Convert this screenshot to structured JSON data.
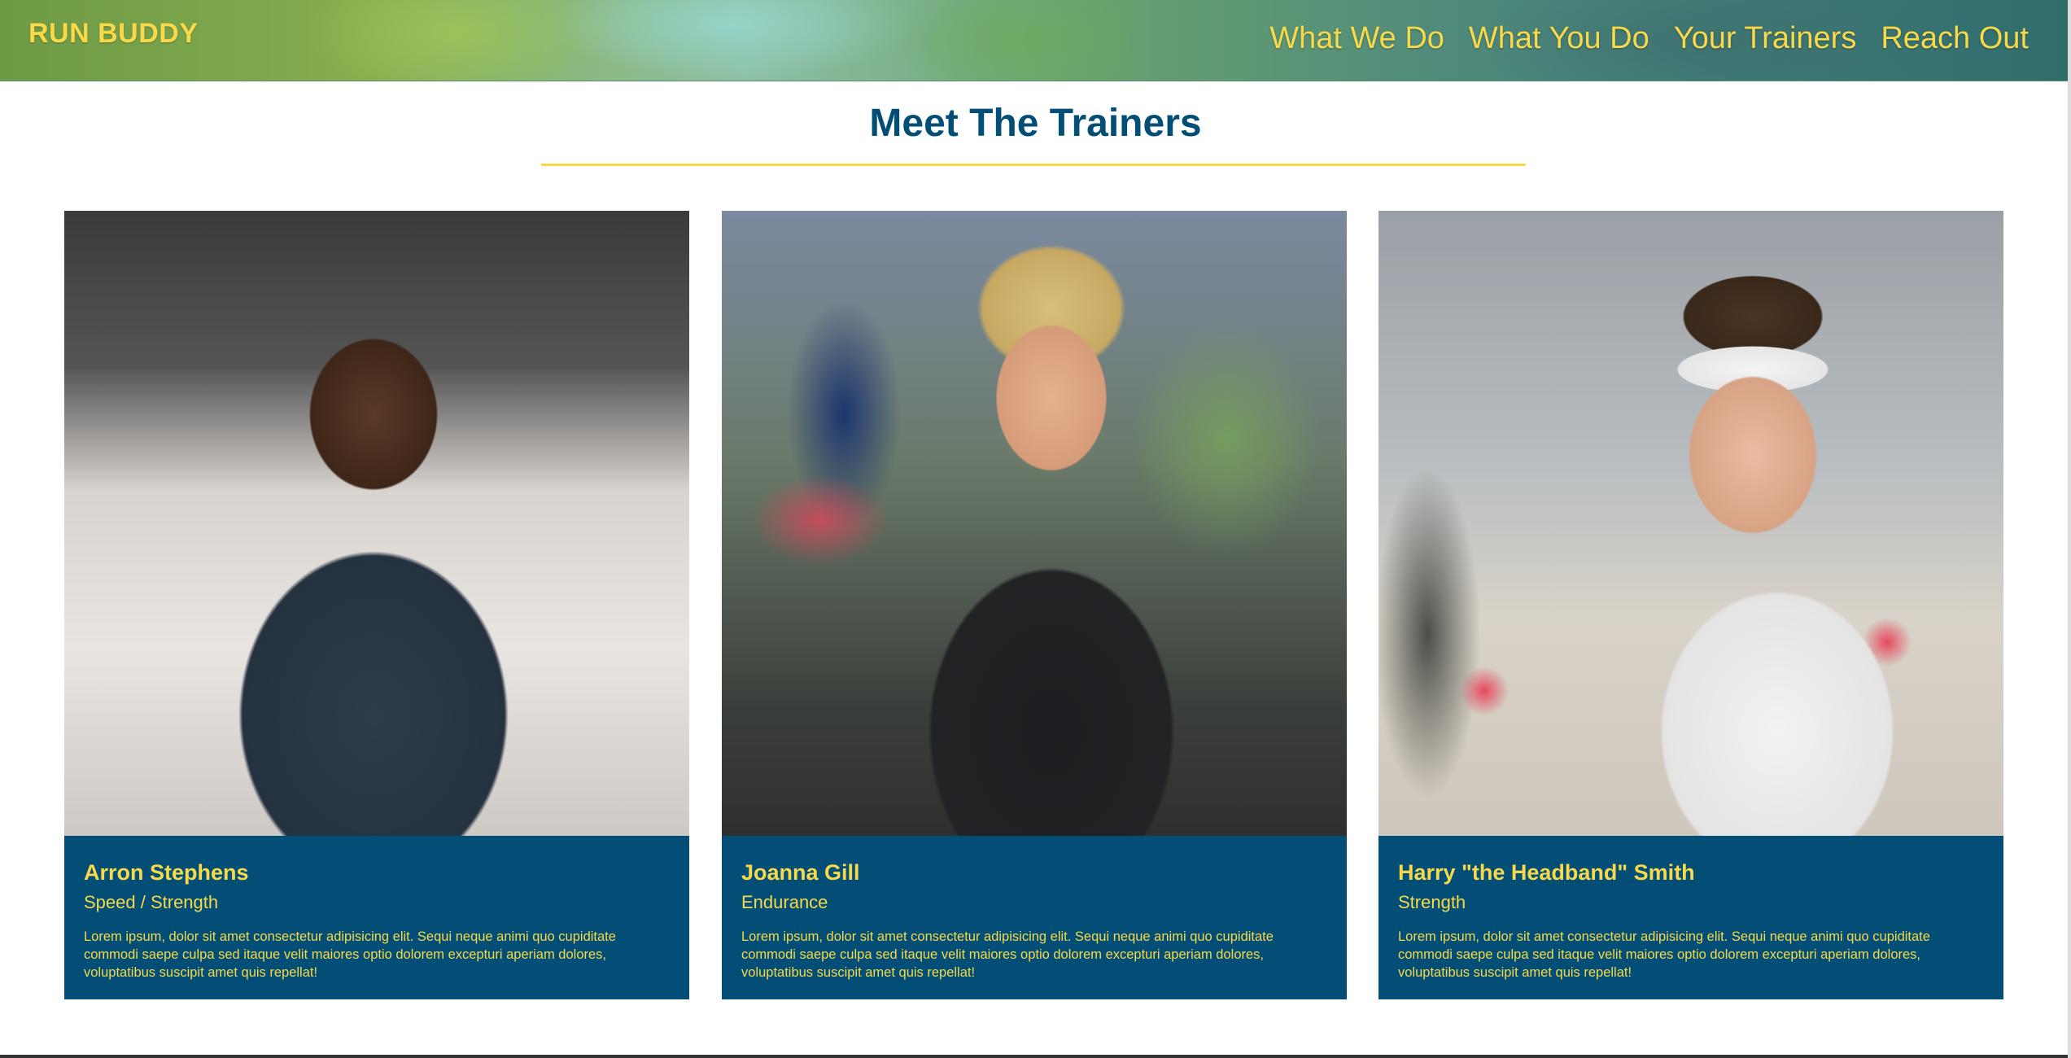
{
  "header": {
    "brand": "RUN BUDDY",
    "nav": [
      {
        "label": "What We Do"
      },
      {
        "label": "What You Do"
      },
      {
        "label": "Your Trainers"
      },
      {
        "label": "Reach Out"
      }
    ]
  },
  "section": {
    "title": "Meet The Trainers"
  },
  "trainers": [
    {
      "name": "Arron Stephens",
      "role": "Speed / Strength",
      "bio": "Lorem ipsum, dolor sit amet consectetur adipisicing elit. Sequi neque animi quo cupiditate commodi saepe culpa sed itaque velit maiores optio dolorem excepturi aperiam dolores, voluptatibus suscipit amet quis repellat!"
    },
    {
      "name": "Joanna Gill",
      "role": "Endurance",
      "bio": "Lorem ipsum, dolor sit amet consectetur adipisicing elit. Sequi neque animi quo cupiditate commodi saepe culpa sed itaque velit maiores optio dolorem excepturi aperiam dolores, voluptatibus suscipit amet quis repellat!"
    },
    {
      "name": "Harry \"the Headband\" Smith",
      "role": "Strength",
      "bio": "Lorem ipsum, dolor sit amet consectetur adipisicing elit. Sequi neque animi quo cupiditate commodi saepe culpa sed itaque velit maiores optio dolorem excepturi aperiam dolores, voluptatibus suscipit amet quis repellat!"
    }
  ],
  "colors": {
    "primary": "#024e76",
    "accent": "#f7d94a",
    "background": "#ffffff"
  }
}
